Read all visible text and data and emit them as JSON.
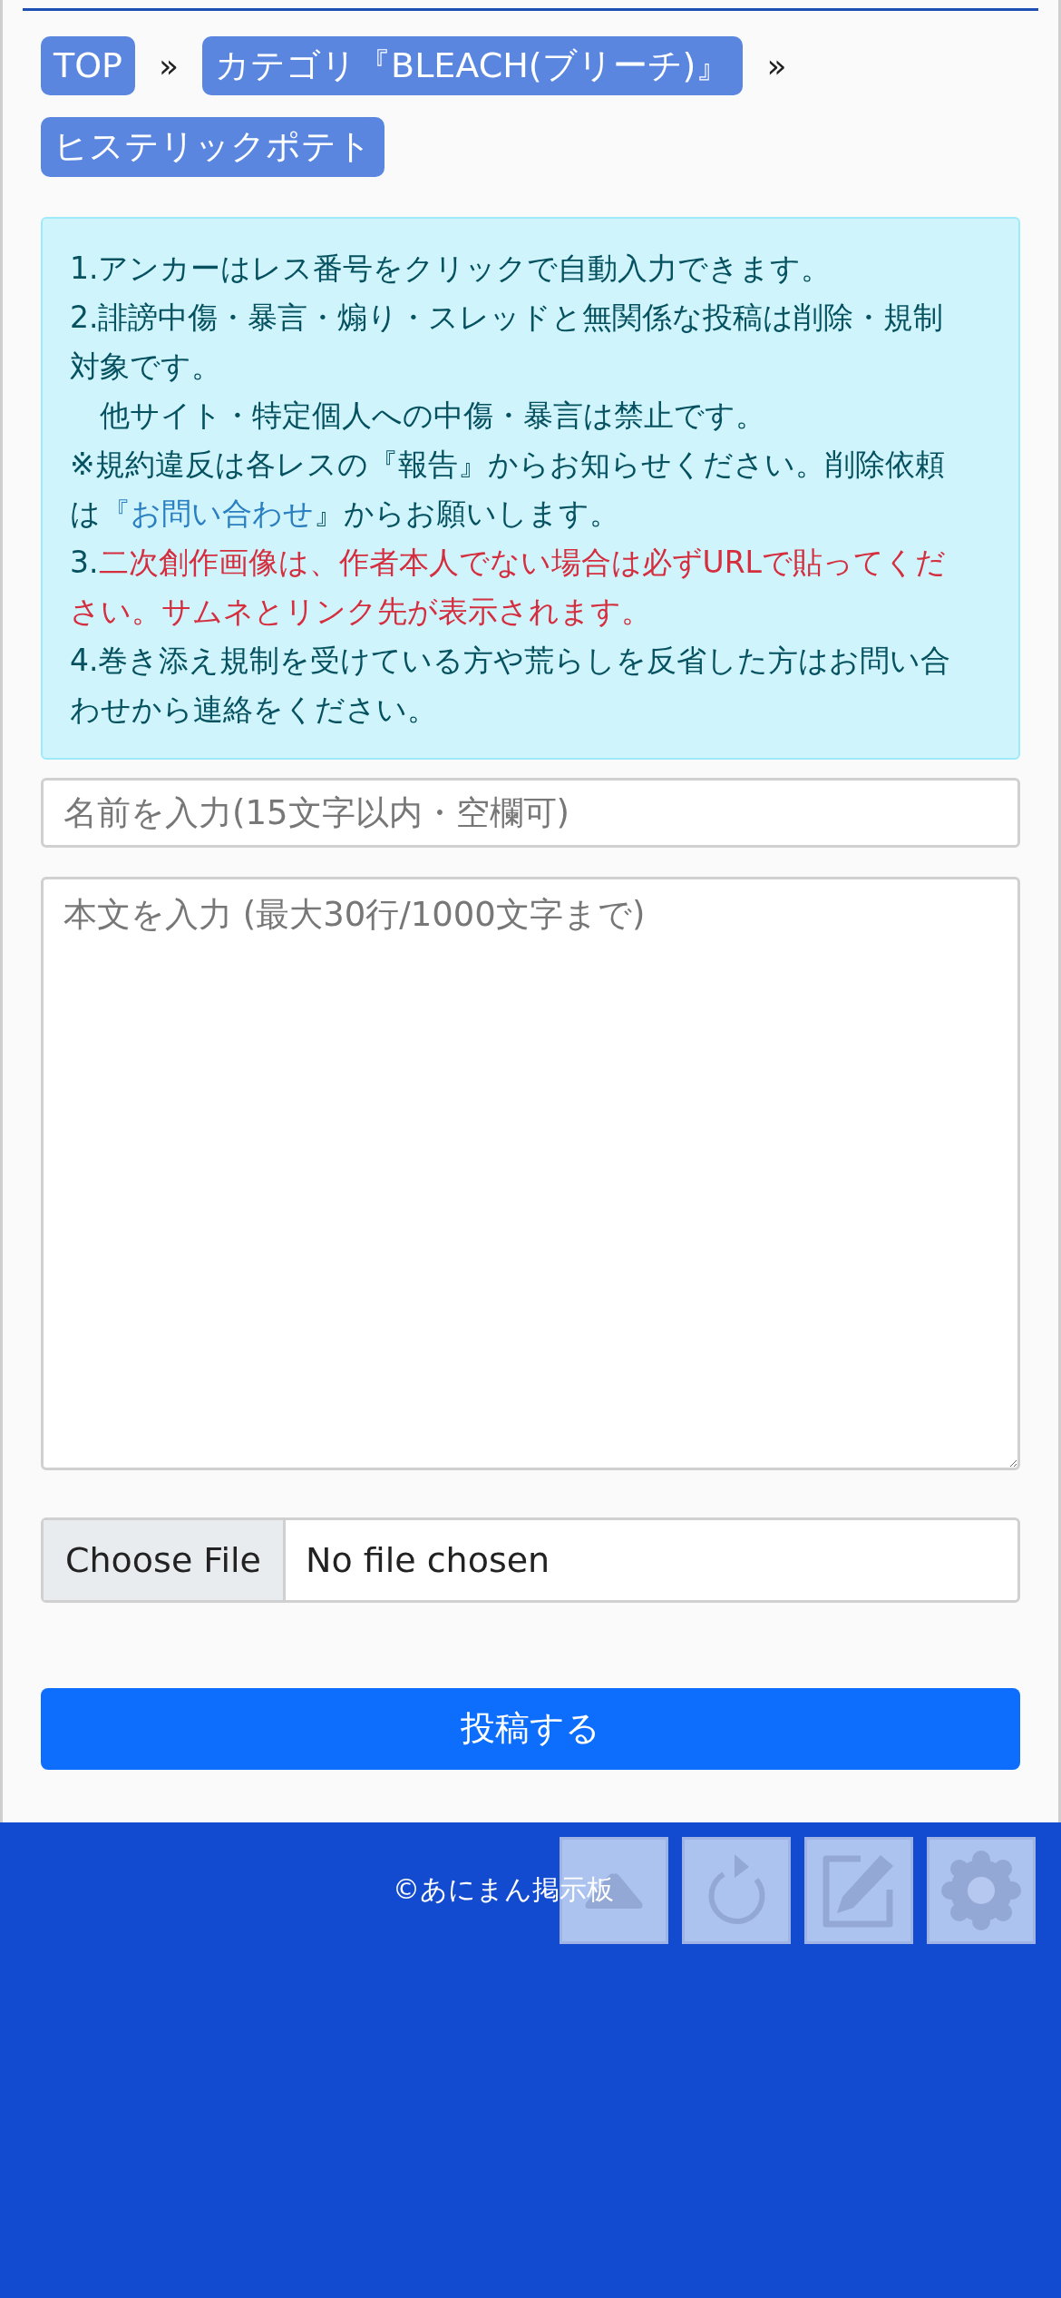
{
  "breadcrumbs": [
    {
      "label": "TOP"
    },
    {
      "label": "カテゴリ『BLEACH(ブリーチ)』"
    },
    {
      "label": "ヒステリックポテト"
    }
  ],
  "breadcrumb_separator": "»",
  "notices": [
    {
      "segments": [
        {
          "kind": "plain",
          "text": "1.アンカーはレス番号をクリックで自動入力できます。"
        }
      ]
    },
    {
      "segments": [
        {
          "kind": "plain",
          "text": "2.誹謗中傷・暴言・煽り・スレッドと無関係な投稿は削除・規制対象です。"
        }
      ]
    },
    {
      "segments": [
        {
          "kind": "plain",
          "text": "　他サイト・特定個人への中傷・暴言は禁止です。"
        }
      ]
    },
    {
      "segments": [
        {
          "kind": "plain",
          "text": "※規約違反は各レスの『報告』からお知らせください。削除依頼は"
        },
        {
          "kind": "link",
          "text": "『お問い合わせ"
        },
        {
          "kind": "plain",
          "text": "』からお願いします。"
        }
      ]
    },
    {
      "segments": [
        {
          "kind": "plain",
          "text": "3."
        },
        {
          "kind": "warning",
          "text": "二次創作画像は、作者本人でない場合は必ずURLで貼ってください。サムネとリンク先が表示されます。"
        }
      ]
    },
    {
      "segments": [
        {
          "kind": "plain",
          "text": "4.巻き添え規制を受けている方や荒らしを反省した方はお問い合わせから連絡をください。"
        }
      ]
    }
  ],
  "name_field": {
    "placeholder": "名前を入力(15文字以内・空欄可)"
  },
  "body_field": {
    "placeholder": "本文を入力 (最大30行/1000文字まで)"
  },
  "file_input": {
    "button": "Choose File",
    "status": "No file chosen"
  },
  "submit_button": "投稿する",
  "footer": {
    "copyright": "©あにまん掲示板"
  },
  "floating_buttons": [
    {
      "kind": "top"
    },
    {
      "kind": "reload"
    },
    {
      "kind": "write"
    },
    {
      "kind": "settings"
    }
  ]
}
